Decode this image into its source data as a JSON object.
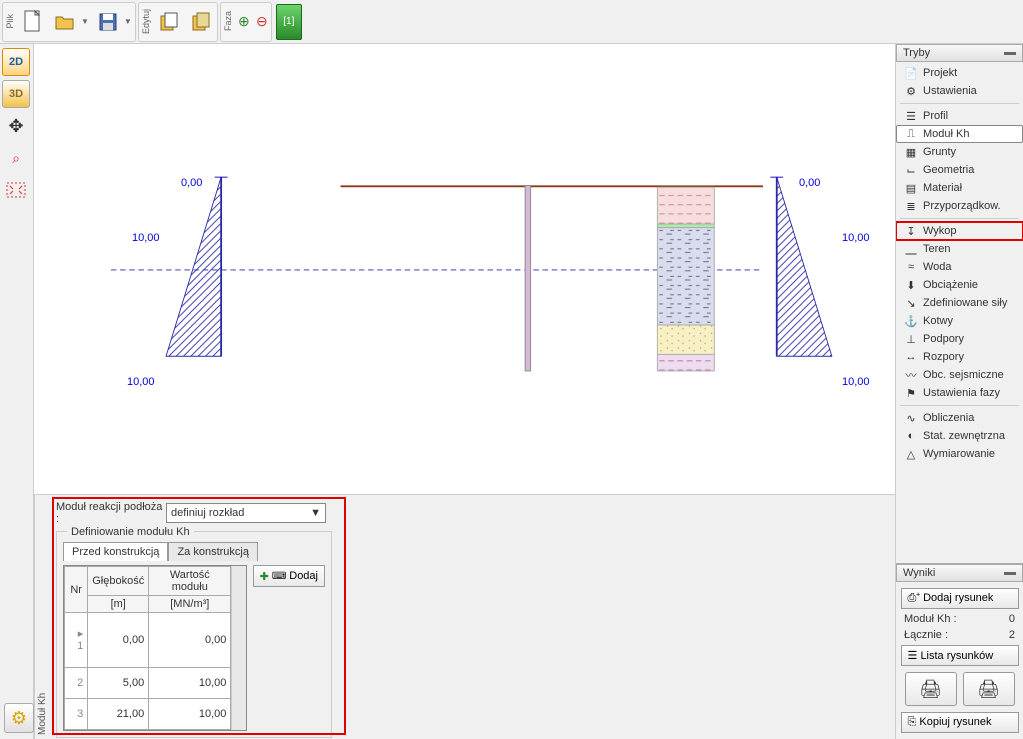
{
  "toolbar": {
    "groups": {
      "file": "Plik",
      "edit": "Edytuj",
      "phase": "Faza"
    },
    "phase_tab": "[1]"
  },
  "left": {
    "btn_2d": "2D",
    "btn_3d": "3D"
  },
  "tree": {
    "header": "Tryby",
    "items": [
      {
        "icon": "📄",
        "label": "Projekt"
      },
      {
        "icon": "⚙",
        "label": "Ustawienia"
      },
      {
        "sep": true
      },
      {
        "icon": "☰",
        "label": "Profil"
      },
      {
        "icon": "⎍",
        "label": "Moduł Kh",
        "selected": true
      },
      {
        "icon": "▦",
        "label": "Grunty"
      },
      {
        "icon": "⌙",
        "label": "Geometria"
      },
      {
        "icon": "▤",
        "label": "Materiał"
      },
      {
        "icon": "≣",
        "label": "Przyporządkow."
      },
      {
        "sep": true
      },
      {
        "icon": "↧",
        "label": "Wykop",
        "highlight": true
      },
      {
        "icon": "⎽",
        "label": "Teren"
      },
      {
        "icon": "≈",
        "label": "Woda"
      },
      {
        "icon": "⬇",
        "label": "Obciążenie"
      },
      {
        "icon": "↘",
        "label": "Zdefiniowane siły"
      },
      {
        "icon": "⚓",
        "label": "Kotwy"
      },
      {
        "icon": "⊥",
        "label": "Podpory"
      },
      {
        "icon": "↔",
        "label": "Rozpory"
      },
      {
        "icon": "〰",
        "label": "Obc. sejsmiczne"
      },
      {
        "icon": "⚑",
        "label": "Ustawienia fazy"
      },
      {
        "sep": true
      },
      {
        "icon": "∿",
        "label": "Obliczenia"
      },
      {
        "icon": "◐",
        "label": "Stat. zewnętrzna"
      },
      {
        "icon": "△",
        "label": "Wymiarowanie"
      }
    ]
  },
  "bottom": {
    "vert_label": "Moduł Kh",
    "field_label": "Moduł reakcji podłoża :",
    "select_value": "definiuj rozkład",
    "group_title": "Definiowanie modułu Kh",
    "tabs": {
      "before": "Przed konstrukcją",
      "after": "Za konstrukcją"
    },
    "table": {
      "headers": {
        "nr": "Nr",
        "depth": "Głębokość",
        "depth_unit": "[m]",
        "value": "Wartość modułu",
        "value_unit": "[MN/m³]"
      },
      "rows": [
        {
          "nr": "1",
          "depth": "0,00",
          "value": "0,00",
          "caret": true
        },
        {
          "nr": "2",
          "depth": "5,00",
          "value": "10,00"
        },
        {
          "nr": "3",
          "depth": "21,00",
          "value": "10,00"
        }
      ]
    },
    "add_btn": "Dodaj"
  },
  "results": {
    "header": "Wyniki",
    "add_drawing": "Dodaj rysunek",
    "rows": [
      {
        "label": "Moduł Kh :",
        "value": "0"
      },
      {
        "label": "Łącznie :",
        "value": "2"
      }
    ],
    "list_btn": "Lista rysunków",
    "copy_btn": "Kopiuj rysunek"
  },
  "chart_data": {
    "type": "diagram",
    "labels": {
      "top_left": "0,00",
      "left_mid": "10,00",
      "left_bot": "10,00",
      "top_right": "0,00",
      "right_mid": "10,00",
      "right_bot": "10,00"
    }
  }
}
